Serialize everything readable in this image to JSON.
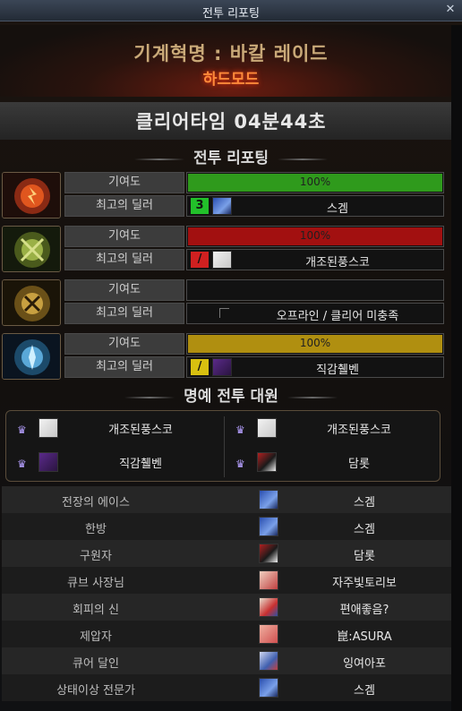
{
  "window": {
    "title": "전투 리포팅",
    "close_icon": "close-icon"
  },
  "dungeon": {
    "name": "기계혁명 : 바칼 레이드",
    "mode": "하드모드"
  },
  "clear_time": "클리어타임  04분44초",
  "battle_report": {
    "heading": "전투 리포팅",
    "contribution_label": "기여도",
    "best_dealer_label": "최고의 딜러",
    "members": [
      {
        "portrait_icon": "red-bakal-emblem-icon",
        "contribution_pct": 100,
        "contribution_text": "100%",
        "bar_color": "#2f9a1c",
        "badge": "3",
        "badge_color": "#22c02a",
        "dealer": "스겜"
      },
      {
        "portrait_icon": "green-bakal-emblem-icon",
        "contribution_pct": 100,
        "contribution_text": "100%",
        "bar_color": "#a21010",
        "badge": "/",
        "badge_color": "#d02020",
        "dealer": "개조된풍스코"
      },
      {
        "portrait_icon": "gold-bakal-emblem-icon",
        "contribution_pct": 0,
        "contribution_text": "",
        "bar_color": "#000000",
        "badge": "",
        "badge_color": "",
        "dealer": "오프라인 / 클리어 미충족"
      },
      {
        "portrait_icon": "blue-bakal-emblem-icon",
        "contribution_pct": 100,
        "contribution_text": "100%",
        "bar_color": "#b08f10",
        "badge": "/",
        "badge_color": "#d8c010",
        "dealer": "직감췔벤"
      }
    ]
  },
  "honor": {
    "heading": "명예 전투 대원",
    "members": [
      {
        "name": "개조된풍스코",
        "icon": "crown-icon"
      },
      {
        "name": "개조된풍스코",
        "icon": "crown-icon"
      },
      {
        "name": "직감췔벤",
        "icon": "crown-icon"
      },
      {
        "name": "담롯",
        "icon": "crown-icon"
      }
    ]
  },
  "awards": [
    {
      "title": "전장의 에이스",
      "name": "스겜"
    },
    {
      "title": "한방",
      "name": "스겜"
    },
    {
      "title": "구원자",
      "name": "담롯"
    },
    {
      "title": "큐브 사장님",
      "name": "자주빛토리보"
    },
    {
      "title": "회피의 신",
      "name": "편애좋음?"
    },
    {
      "title": "제압자",
      "name": "崑:ASURA"
    },
    {
      "title": "큐어 달인",
      "name": "잉여아포"
    },
    {
      "title": "상태이상 전문가",
      "name": "스겜"
    }
  ]
}
